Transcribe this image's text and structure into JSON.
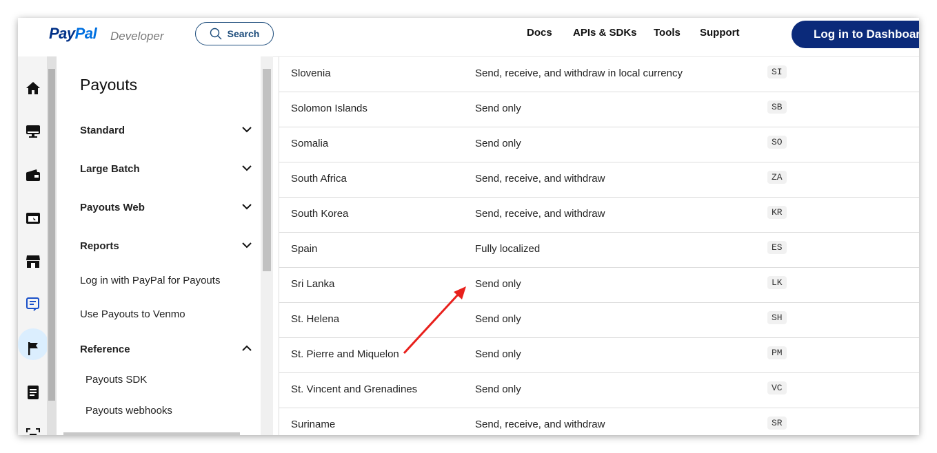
{
  "header": {
    "logo_main": "Pay",
    "logo_accent": "Pal",
    "logo_sub": "Developer",
    "search_label": "Search",
    "nav": [
      "Docs",
      "APIs & SDKs",
      "Tools",
      "Support"
    ],
    "login_label": "Log in to Dashboard"
  },
  "rail": {
    "icons": [
      "home-icon",
      "monitor-icon",
      "wallet-icon",
      "cart-icon",
      "store-icon",
      "payouts-icon",
      "flag-icon",
      "document-icon",
      "scan-icon"
    ],
    "active_icon": "payouts-icon"
  },
  "sidebar": {
    "title": "Payouts",
    "items": [
      {
        "label": "Standard",
        "expandable": true,
        "expanded": false
      },
      {
        "label": "Large Batch",
        "expandable": true,
        "expanded": false
      },
      {
        "label": "Payouts Web",
        "expandable": true,
        "expanded": false
      },
      {
        "label": "Reports",
        "expandable": true,
        "expanded": false
      },
      {
        "label": "Log in with PayPal for Payouts",
        "expandable": false
      },
      {
        "label": "Use Payouts to Venmo",
        "expandable": false
      },
      {
        "label": "Reference",
        "expandable": true,
        "expanded": true
      },
      {
        "label": "Payouts SDK",
        "expandable": false
      },
      {
        "label": "Payouts webhooks",
        "expandable": false
      }
    ]
  },
  "table": {
    "rows": [
      {
        "country": "Slovenia",
        "support": "Send, receive, and withdraw in local currency",
        "code": "SI"
      },
      {
        "country": "Solomon Islands",
        "support": "Send only",
        "code": "SB"
      },
      {
        "country": "Somalia",
        "support": "Send only",
        "code": "SO"
      },
      {
        "country": "South Africa",
        "support": "Send, receive, and withdraw",
        "code": "ZA"
      },
      {
        "country": "South Korea",
        "support": "Send, receive, and withdraw",
        "code": "KR"
      },
      {
        "country": "Spain",
        "support": "Fully localized",
        "code": "ES"
      },
      {
        "country": "Sri Lanka",
        "support": "Send only",
        "code": "LK"
      },
      {
        "country": "St. Helena",
        "support": "Send only",
        "code": "SH"
      },
      {
        "country": "St. Pierre and Miquelon",
        "support": "Send only",
        "code": "PM"
      },
      {
        "country": "St. Vincent and Grenadines",
        "support": "Send only",
        "code": "VC"
      },
      {
        "country": "Suriname",
        "support": "Send, receive, and withdraw",
        "code": "SR"
      }
    ]
  },
  "colors": {
    "brand_dark": "#003087",
    "brand_light": "#0070e0",
    "login_bg": "#0b2a7a",
    "annotation_arrow": "#e8201c"
  }
}
